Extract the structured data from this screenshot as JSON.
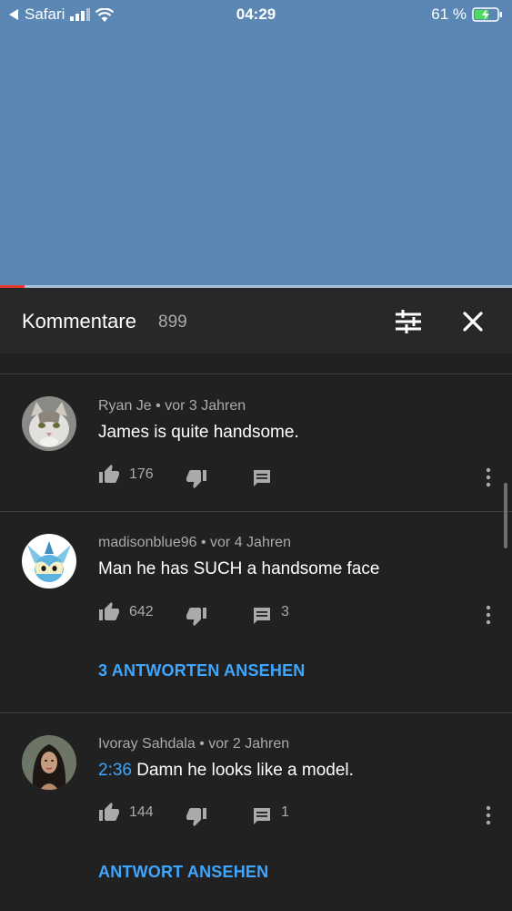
{
  "status_bar": {
    "back_app": "Safari",
    "time": "04:29",
    "battery": "61 %"
  },
  "comments_panel": {
    "title": "Kommentare",
    "count": "899"
  },
  "comments": [
    {
      "author": "Ryan Je",
      "age": "vor 3 Jahren",
      "timestamp": "",
      "text": "James is quite handsome.",
      "likes": "176",
      "reply_count": "",
      "replies_link": ""
    },
    {
      "author": "madisonblue96",
      "age": "vor 4 Jahren",
      "timestamp": "",
      "text": "Man he has SUCH a handsome face",
      "likes": "642",
      "reply_count": "3",
      "replies_link": "3 ANTWORTEN ANSEHEN"
    },
    {
      "author": "Ivoray Sahdala",
      "age": "vor 2 Jahren",
      "timestamp": "2:36",
      "text": " Damn he looks like a model.",
      "likes": "144",
      "reply_count": "1",
      "replies_link": "ANTWORT ANSEHEN"
    }
  ],
  "colors": {
    "video_background": "#5b87b5",
    "panel_background": "#212121",
    "link_blue": "#3ea6ff",
    "progress_red": "#e53935"
  },
  "icons": [
    "back-triangle-icon",
    "signal-icon",
    "wifi-icon",
    "battery-charging-icon",
    "filter-icon",
    "close-icon",
    "thumb-up-icon",
    "thumb-down-icon",
    "reply-icon",
    "more-vert-icon"
  ]
}
